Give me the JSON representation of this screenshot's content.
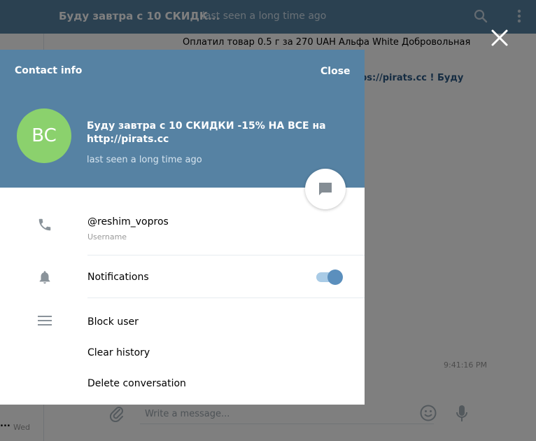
{
  "topbar": {
    "chat_title": "Буду завтра с 10 СКИДК...",
    "chat_status": "last seen a long time ago",
    "search_icon": "search-icon",
    "more_icon": "more-vertical-icon"
  },
  "chat": {
    "message_line": "Оплатил товар 0.5 г за 270 UAH Альфа White Добровольная",
    "link_fragment": "ps://pirats.cc ! Буду",
    "time": "9:41:16 PM"
  },
  "left_pane": {
    "ellipsis": "...",
    "day": "Wed"
  },
  "composer": {
    "placeholder": "Write a message...",
    "attach_icon": "paperclip-icon",
    "emoji_icon": "smile-icon",
    "mic_icon": "microphone-icon"
  },
  "modal": {
    "title": "Contact info",
    "close_label": "Close",
    "avatar_initials": "BC",
    "peer_name": "Буду завтра с 10 СКИДКИ -15% НА ВСЕ на http://pirats.cc",
    "peer_status": "last seen a long time ago",
    "username_value": "@reshim_vopros",
    "username_label": "Username",
    "notifications_label": "Notifications",
    "notifications_on": true,
    "actions": [
      "Block user",
      "Clear history",
      "Delete conversation"
    ]
  },
  "colors": {
    "header_blue": "#5682a3",
    "avatar_green": "#8bd16d",
    "toggle_on": "#5b8fbd"
  }
}
